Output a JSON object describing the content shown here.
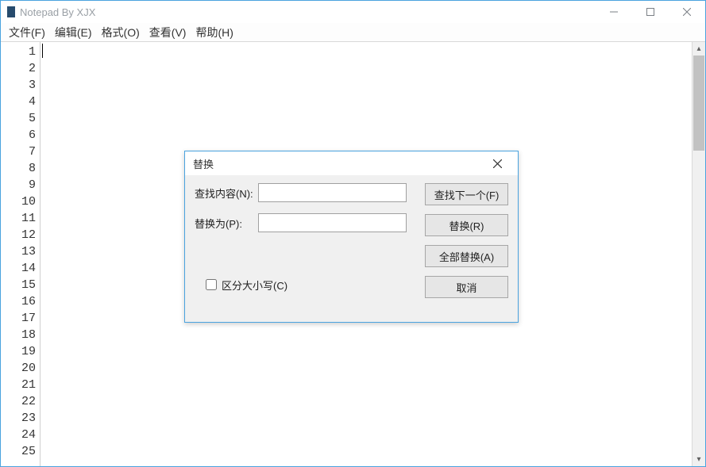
{
  "window": {
    "title": "Notepad By XJX"
  },
  "menu": {
    "file": "文件(F)",
    "edit": "编辑(E)",
    "format": "格式(O)",
    "view": "查看(V)",
    "help": "帮助(H)"
  },
  "editor": {
    "line_count": 25
  },
  "dialog": {
    "title": "替换",
    "find_label": "查找内容(N):",
    "replace_label": "替换为(P):",
    "find_value": "",
    "replace_value": "",
    "match_case_label": "区分大小写(C)",
    "match_case_checked": false,
    "buttons": {
      "find_next": "查找下一个(F)",
      "replace": "替换(R)",
      "replace_all": "全部替换(A)",
      "cancel": "取消"
    }
  }
}
